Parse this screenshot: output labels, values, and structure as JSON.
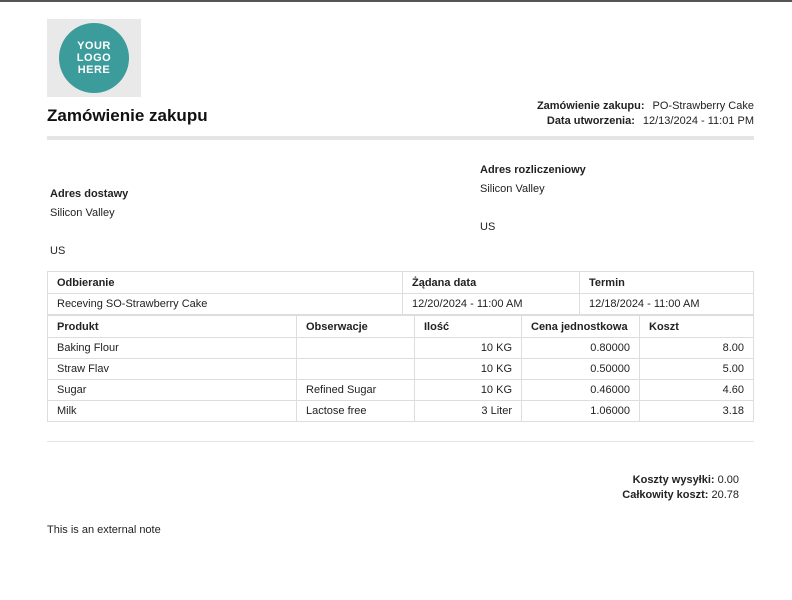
{
  "logo_text": [
    "YOUR",
    "LOGO",
    "HERE"
  ],
  "title": "Zamówienie zakupu",
  "meta": {
    "order_label": "Zamówienie zakupu:",
    "order_value": "PO-Strawberry Cake",
    "created_label": "Data utworzenia:",
    "created_value": "12/13/2024 - 11:01 PM"
  },
  "delivery": {
    "heading": "Adres dostawy",
    "line1": "Silicon Valley",
    "line2": "US"
  },
  "billing": {
    "heading": "Adres rozliczeniowy",
    "line1": "Silicon Valley",
    "line2": "US"
  },
  "receiving": {
    "headers": [
      "Odbieranie",
      "Żądana data",
      "Termin"
    ],
    "row": [
      "Receving SO-Strawberry Cake",
      "12/20/2024 - 11:00 AM",
      "12/18/2024 - 11:00 AM"
    ]
  },
  "products": {
    "headers": [
      "Produkt",
      "Obserwacje",
      "Ilość",
      "Cena jednostkowa",
      "Koszt"
    ],
    "rows": [
      [
        "Baking Flour",
        "",
        "10 KG",
        "0.80000",
        "8.00"
      ],
      [
        "Straw Flav",
        "",
        "10 KG",
        "0.50000",
        "5.00"
      ],
      [
        "Sugar",
        "Refined Sugar",
        "10 KG",
        "0.46000",
        "4.60"
      ],
      [
        "Milk",
        "Lactose free",
        "3 Liter",
        "1.06000",
        "3.18"
      ]
    ]
  },
  "totals": {
    "shipping_label": "Koszty wysyłki:",
    "shipping_value": "0.00",
    "total_label": "Całkowity koszt:",
    "total_value": "20.78"
  },
  "note": "This is an external note"
}
